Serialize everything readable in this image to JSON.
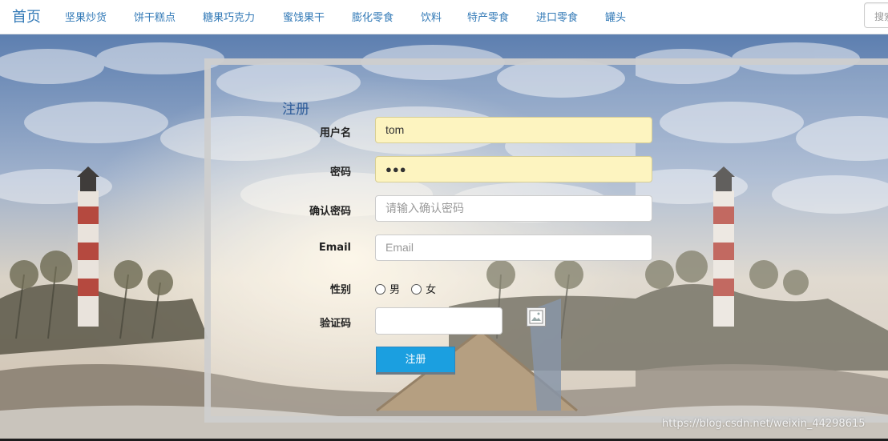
{
  "navbar": {
    "brand": "首页",
    "items": [
      "坚果炒货",
      "饼干糕点",
      "糖果巧克力",
      "蜜饯果干",
      "膨化零食",
      "饮料",
      "特产零食",
      "进口零食",
      "罐头"
    ],
    "search_placeholder": "搜索"
  },
  "form": {
    "title": "注册",
    "username": {
      "label": "用户名",
      "value": "tom"
    },
    "password": {
      "label": "密码",
      "value_masked": "●●●"
    },
    "confirm_password": {
      "label": "确认密码",
      "placeholder": "请输入确认密码"
    },
    "email": {
      "label": "Email",
      "placeholder": "Email"
    },
    "gender": {
      "label": "性别",
      "options": [
        "男",
        "女"
      ]
    },
    "captcha": {
      "label": "验证码"
    },
    "submit_label": "注册"
  },
  "watermark": "https://blog.csdn.net/weixin_44298615",
  "colors": {
    "link": "#337ab7",
    "autofill": "#fdf4c0",
    "button": "#1b9fe0"
  }
}
